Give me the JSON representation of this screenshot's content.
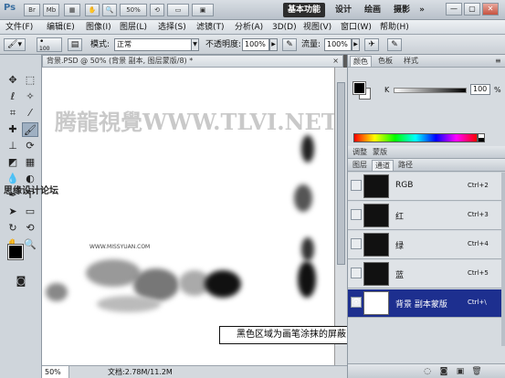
{
  "app": {
    "logo": "Ps",
    "title_buttons": [
      "Br",
      "Mb"
    ],
    "zoom_dropdown": "50%",
    "workspaces": [
      "基本功能",
      "设计",
      "绘画",
      "摄影"
    ],
    "active_workspace": "基本功能",
    "window_controls": [
      "minimize",
      "restore",
      "close"
    ]
  },
  "menu": {
    "items": [
      "文件(F)",
      "编辑(E)",
      "图像(I)",
      "图层(L)",
      "选择(S)",
      "滤镜(T)",
      "分析(A)",
      "3D(D)",
      "视图(V)",
      "窗口(W)",
      "帮助(H)"
    ]
  },
  "options": {
    "brush_size": "100",
    "mode_label": "模式:",
    "mode_value": "正常",
    "opacity_label": "不透明度:",
    "opacity_value": "100%",
    "flow_label": "流量:",
    "flow_value": "100%"
  },
  "document": {
    "tab_title": "背景.PSD @ 50% (背景 副本, 图层蒙版/8) *",
    "tab_close": "×",
    "zoom": "50%",
    "info": "文档:2.78M/11.2M",
    "watermark_main": "腾龍視覺WWW.TLVI.NET",
    "watermark_small": "WWW.MISSYUAN.COM",
    "forum_label": "思缘设计论坛"
  },
  "annotation": {
    "text": "黑色区域为画笔涂抹的屏蔽区域"
  },
  "color_panel": {
    "tabs": [
      "颜色",
      "色板",
      "样式"
    ],
    "active_tab": "颜色",
    "channel_label": "K",
    "value": "100",
    "unit": "%",
    "foreground": "#000000",
    "background": "#ffffff"
  },
  "channels_panel": {
    "top_tabs": [
      "调整",
      "蒙版"
    ],
    "tabs": [
      "图层",
      "通道",
      "路径"
    ],
    "active_tab": "通道",
    "rows": [
      {
        "name": "RGB",
        "shortcut": "Ctrl+2",
        "selected": false
      },
      {
        "name": "红",
        "shortcut": "Ctrl+3",
        "selected": false
      },
      {
        "name": "绿",
        "shortcut": "Ctrl+4",
        "selected": false
      },
      {
        "name": "蓝",
        "shortcut": "Ctrl+5",
        "selected": false
      },
      {
        "name": "背景 副本蒙版",
        "shortcut": "Ctrl+\\",
        "selected": true
      }
    ]
  },
  "colors": {
    "selected_row": "#1d2f8f",
    "active_workspace_bg": "#2d2d2d"
  }
}
